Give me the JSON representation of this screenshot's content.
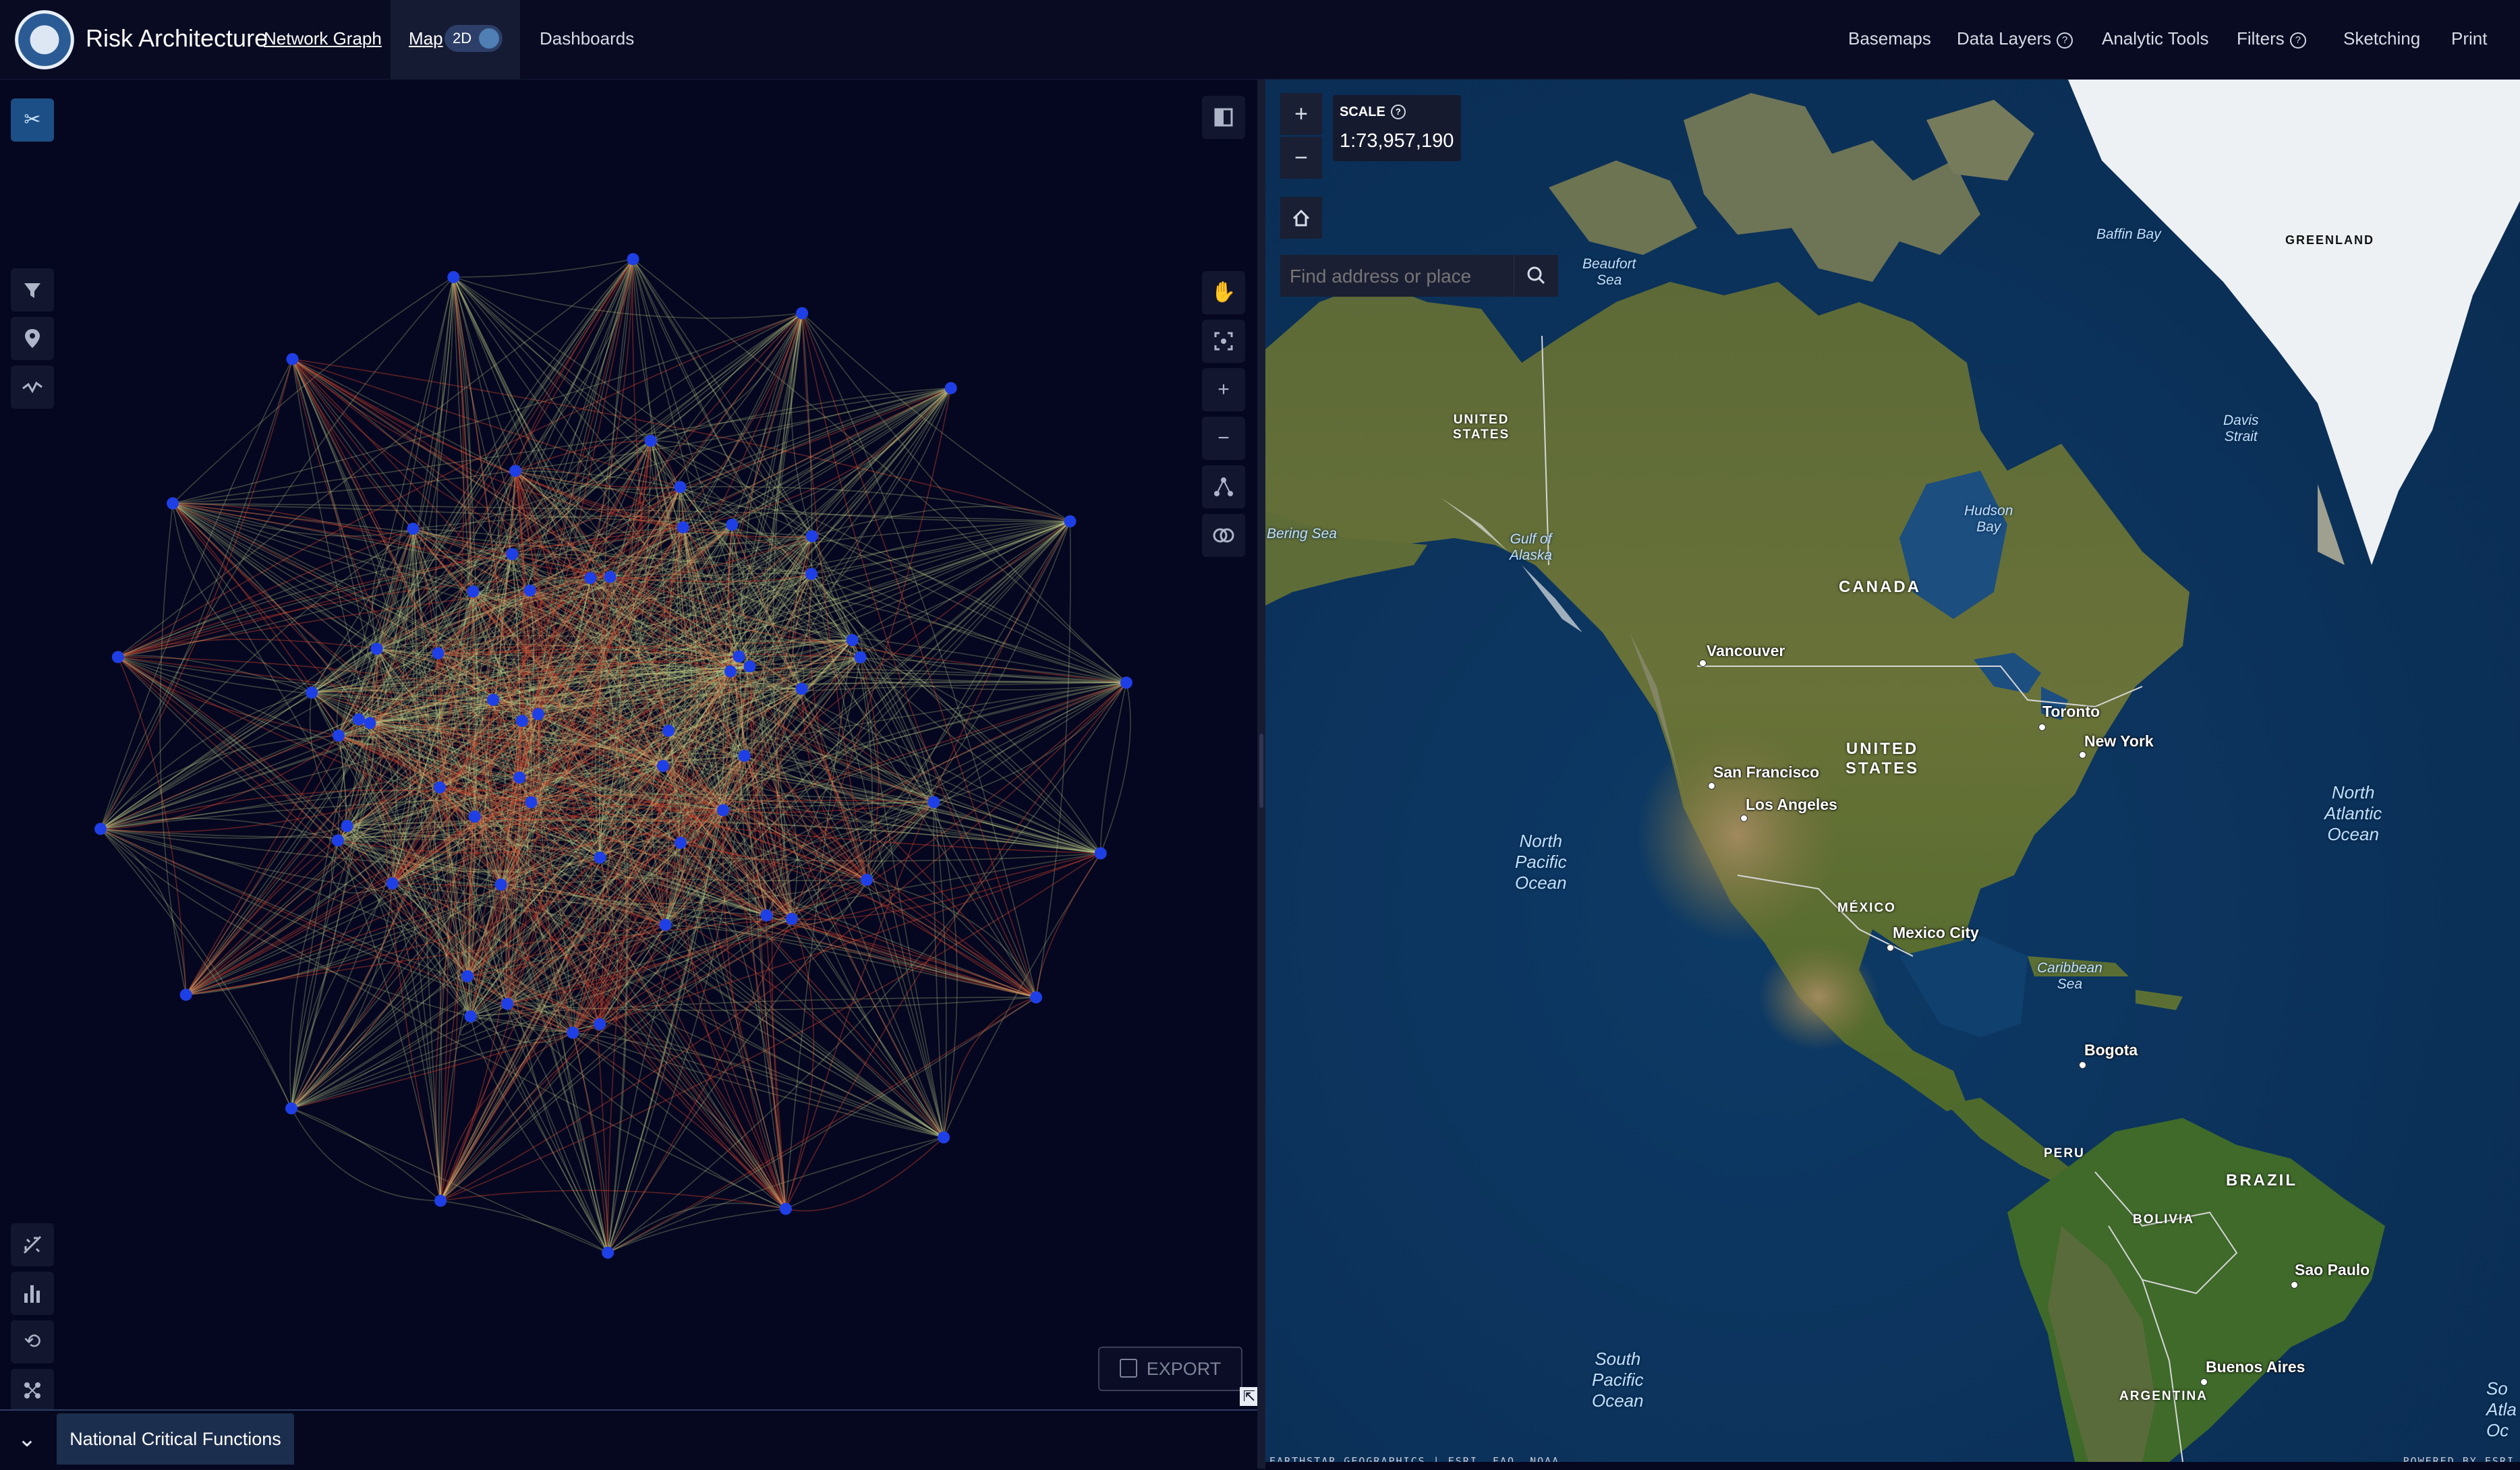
{
  "header": {
    "title": "Risk Architecture",
    "nav": {
      "network_graph": "Network Graph",
      "map": "Map",
      "toggle_label": "2D",
      "dashboards": "Dashboards"
    },
    "right_nav": {
      "basemaps": "Basemaps",
      "data_layers": "Data Layers",
      "analytic_tools": "Analytic Tools",
      "filters": "Filters",
      "sketching": "Sketching",
      "print": "Print"
    },
    "help_glyph": "?"
  },
  "graph_panel": {
    "export_label": "EXPORT",
    "bottom_tab": "National Critical Functions",
    "colors": {
      "edge_green": "#c9d98a",
      "edge_red": "#c8402a",
      "node": "#1f3fe6"
    },
    "node_count": 70,
    "icons": {
      "top_left": "cut-link-icon",
      "left_tools": [
        "filter-icon",
        "location-pin-icon",
        "path-icon"
      ],
      "right_tools": [
        "panel-toggle-icon",
        "pan-hand-icon",
        "zoom-to-fit-icon",
        "zoom-in-icon",
        "zoom-out-icon",
        "hierarchy-icon",
        "overlap-icon"
      ],
      "bottom_tools": [
        "auto-layout-icon",
        "bar-chart-icon",
        "reset-icon",
        "scatter-layout-icon"
      ]
    }
  },
  "map": {
    "scale_title": "SCALE",
    "scale_value": "1:73,957,190",
    "search_placeholder": "Find address or place",
    "attribution": "EARTHSTAR GEOGRAPHICS | ESRI, FAO, NOAA",
    "powered_by": "POWERED BY ESRI",
    "labels": {
      "baffin_bay": "Baffin Bay",
      "greenland": "GREENLAND",
      "beaufort_sea": "Beaufort\nSea",
      "davis_strait": "Davis\nStrait",
      "united_states_alaska": "UNITED\nSTATES",
      "bering_sea": "Bering Sea",
      "gulf_of_alaska": "Gulf of\nAlaska",
      "hudson_bay": "Hudson\nBay",
      "canada": "CANADA",
      "united_states": "UNITED\nSTATES",
      "north_atlantic": "North\nAtlantic\nOcean",
      "north_pacific": "North\nPacific\nOcean",
      "mexico": "MÉXICO",
      "caribbean": "Caribbean\nSea",
      "peru": "PERU",
      "brazil": "BRAZIL",
      "bolivia": "BOLIVIA",
      "argentina": "ARGENTINA",
      "south_pacific": "South\nPacific\nOcean",
      "south_atlantic_partial": "So\nAtla\nOc"
    },
    "cities": {
      "vancouver": "Vancouver",
      "toronto": "Toronto",
      "new_york": "New York",
      "san_francisco": "San Francisco",
      "los_angeles": "Los Angeles",
      "mexico_city": "Mexico City",
      "bogota": "Bogota",
      "sao_paulo": "Sao Paulo",
      "buenos_aires": "Buenos Aires"
    },
    "colors": {
      "ocean": "#0f3760",
      "land": "#5c6b32",
      "ice": "#f2f4f6"
    }
  }
}
